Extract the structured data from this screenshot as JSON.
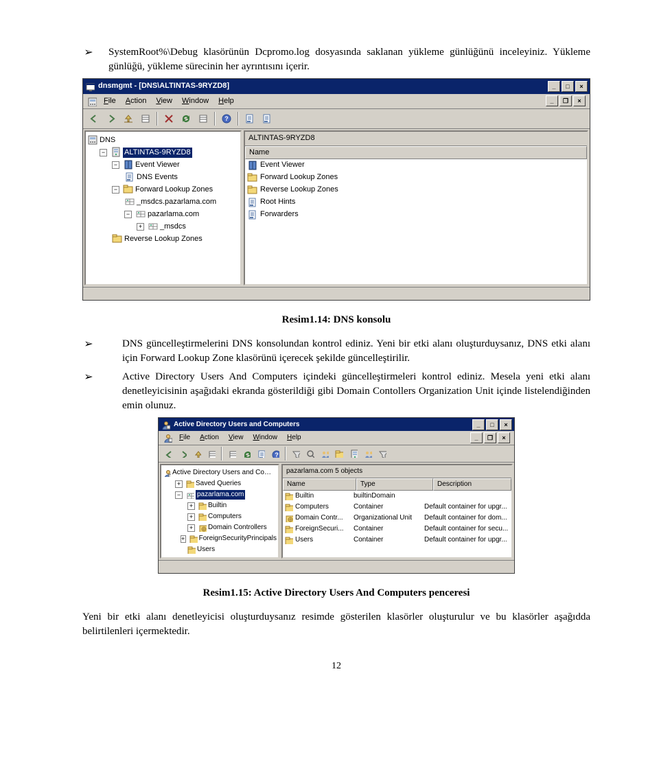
{
  "para1": "SystemRoot%\\Debug klasörünün Dcpromo.log dosyasında saklanan yükleme günlüğünü inceleyiniz. Yükleme günlüğü, yükleme sürecinin her ayrıntısını içerir.",
  "caption1": "Resim1.14: DNS konsolu",
  "para2": "DNS güncelleştirmelerini DNS konsolundan kontrol ediniz. Yeni bir etki alanı oluşturduysanız, DNS etki alanı için Forward Lookup Zone klasörünü içerecek şekilde güncelleştirilir.",
  "para3": "Active Directory Users And Computers içindeki güncelleştirmeleri kontrol ediniz. Mesela yeni etki alanı denetleyicisinin aşağıdaki ekranda gösterildiği gibi Domain Contollers Organization Unit içinde listelendiğinden emin olunuz.",
  "caption2": "Resim1.15: Active Directory Users And Computers penceresi",
  "para4": "Yeni bir etki alanı denetleyicisi oluşturduysanız resimde gösterilen klasörler oluşturulur ve bu klasörler aşağıdda belirtilenleri içermektedir.",
  "bullet": "➢",
  "page_num": "12",
  "sh1": {
    "title": "dnsmgmt - [DNS\\ALTINTAS-9RYZD8]",
    "menus": [
      "File",
      "Action",
      "View",
      "Window",
      "Help"
    ],
    "addr": "ALTINTAS-9RYZD8",
    "tree_root": "DNS",
    "tree_sel": "ALTINTAS-9RYZD8",
    "tree_items": [
      "Event Viewer",
      "DNS Events",
      "Forward Lookup Zones",
      "_msdcs.pazarlama.com",
      "pazarlama.com",
      "_msdcs",
      "Reverse Lookup Zones"
    ],
    "cols": [
      "Name"
    ],
    "rows": [
      {
        "icon": "book",
        "name": "Event Viewer"
      },
      {
        "icon": "folder",
        "name": "Forward Lookup Zones"
      },
      {
        "icon": "folder",
        "name": "Reverse Lookup Zones"
      },
      {
        "icon": "doc",
        "name": "Root Hints"
      },
      {
        "icon": "doc",
        "name": "Forwarders"
      }
    ]
  },
  "sh2": {
    "title": "Active Directory Users and Computers",
    "menus": [
      "File",
      "Action",
      "View",
      "Window",
      "Help"
    ],
    "addr": "pazarlama.com   5 objects",
    "tree_root": "Active Directory Users and Computers",
    "tree_items": [
      "Saved Queries",
      "pazarlama.com",
      "Builtin",
      "Computers",
      "Domain Controllers",
      "ForeignSecurityPrincipals",
      "Users"
    ],
    "cols": [
      "Name",
      "Type",
      "Description"
    ],
    "rows": [
      {
        "icon": "folder",
        "name": "Builtin",
        "type": "builtinDomain",
        "desc": ""
      },
      {
        "icon": "folder",
        "name": "Computers",
        "type": "Container",
        "desc": "Default container for upgr..."
      },
      {
        "icon": "ou",
        "name": "Domain Contr...",
        "type": "Organizational Unit",
        "desc": "Default container for dom..."
      },
      {
        "icon": "folder",
        "name": "ForeignSecuri...",
        "type": "Container",
        "desc": "Default container for secu..."
      },
      {
        "icon": "folder",
        "name": "Users",
        "type": "Container",
        "desc": "Default container for upgr..."
      }
    ]
  }
}
